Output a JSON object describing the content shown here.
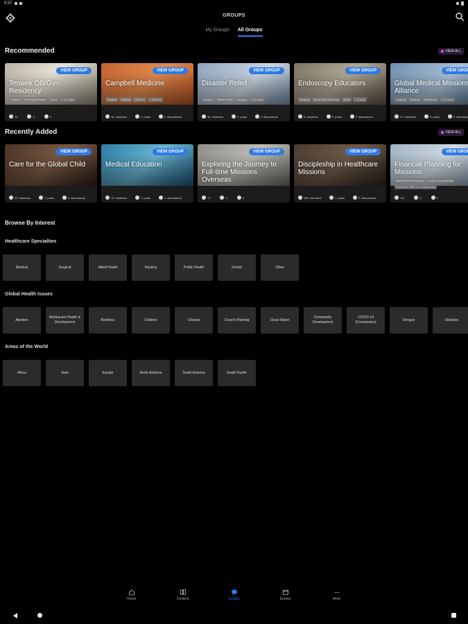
{
  "status_bar": {
    "time": "9:37"
  },
  "header": {
    "title": "GROUPS",
    "tabs": [
      {
        "label": "My Groups",
        "active": false
      },
      {
        "label": "All Groups",
        "active": true
      }
    ]
  },
  "view_group_label": "VIEW GROUP",
  "recommended": {
    "title": "Recommended",
    "view_all": "VIEW ALL",
    "cards": [
      {
        "name": "Tenwek OB/Gyn Residency",
        "chips": [
          "Surgical",
          "Birthing Wellness",
          "Africa",
          "+ 12 more"
        ],
        "stats": {
          "members": "10",
          "posts": "3",
          "discussions": "4"
        },
        "labels": {
          "members": "",
          "posts": "",
          "discussions": ""
        }
      },
      {
        "name": "Campbell Medicine",
        "chips": [
          "Surgical",
          "Medical",
          "Children",
          "+ 29 more"
        ],
        "stats": {
          "members": "16",
          "posts": "1",
          "discussions": "0"
        },
        "labels": {
          "members": "members",
          "posts": "posts",
          "discussions": "discussions"
        }
      },
      {
        "name": "Disaster Relief",
        "chips": [
          "Surgical",
          "Allied Health",
          "Nursing",
          "+ 22 more"
        ],
        "stats": {
          "members": "35",
          "posts": "0",
          "discussions": "2"
        },
        "labels": {
          "members": "members",
          "posts": "posts",
          "discussions": "discussions"
        }
      },
      {
        "name": "Endoscopy Educators",
        "chips": [
          "Surgical",
          "Short-Term Missions",
          "Africa",
          "+ 3 more"
        ],
        "stats": {
          "members": "5",
          "posts": "0",
          "discussions": "2"
        },
        "labels": {
          "members": "members",
          "posts": "posts",
          "discussions": "discussions"
        }
      },
      {
        "name": "Global Medical Missions Alliance",
        "chips": [
          "Surgical",
          "Medical",
          "Residency",
          "+ 22 more"
        ],
        "stats": {
          "members": "17",
          "posts": "0",
          "discussions": "0"
        },
        "labels": {
          "members": "members",
          "posts": "posts",
          "discussions": "discussions"
        }
      }
    ]
  },
  "recently_added": {
    "title": "Recently Added",
    "view_all": "VIEW ALL",
    "cards": [
      {
        "name": "Care for the Global Child",
        "chips": [],
        "stats": {
          "members": "23",
          "posts": "1",
          "discussions": "0"
        },
        "labels": {
          "members": "members",
          "posts": "posts",
          "discussions": "discussions"
        }
      },
      {
        "name": "Medical Education",
        "chips": [],
        "stats": {
          "members": "10",
          "posts": "1",
          "discussions": "1"
        },
        "labels": {
          "members": "members",
          "posts": "posts",
          "discussions": "discussions"
        }
      },
      {
        "name": "Exploring the Journey to Full-time Missions Overseas",
        "chips": [],
        "stats": {
          "members": "17",
          "posts": "0",
          "discussions": "0"
        },
        "labels": {
          "members": "",
          "posts": "",
          "discussions": ""
        }
      },
      {
        "name": "Discipleship in Healthcare Missions",
        "chips": [],
        "stats": {
          "members": "158",
          "posts": "0",
          "discussions": "0"
        },
        "labels": {
          "members": "members",
          "posts": "posts",
          "discussions": "discussions"
        }
      },
      {
        "name": "Financial Planning for Missions",
        "chips": [
          "Medical Press Readers",
          "Long-Term Missions",
          "Reflecting Skills as a Missionary"
        ],
        "stats": {
          "members": "113",
          "posts": "0",
          "discussions": "0"
        },
        "labels": {
          "members": "",
          "posts": "",
          "discussions": ""
        }
      }
    ]
  },
  "browse": {
    "title": "Browse By Interest",
    "healthcare": {
      "title": "Healthcare Specialties",
      "items": [
        "Medical",
        "Surgical",
        "Allied Health",
        "Nursing",
        "Public Health",
        "Dental",
        "Other"
      ]
    },
    "global_health": {
      "title": "Global Health Issues",
      "items": [
        "Abortion",
        "Adolescent Health & Development",
        "Bioethics",
        "Children",
        "Cholera",
        "Church Planting",
        "Clean Water",
        "Community Development",
        "COVID-19 (Coronavirus)",
        "Dengue",
        "Diabetes"
      ]
    },
    "areas": {
      "title": "Areas of the World",
      "items": [
        "Africa",
        "Asia",
        "Europe",
        "North America",
        "South America",
        "South Pacific"
      ]
    }
  },
  "bottom_nav": [
    {
      "label": "Home",
      "icon": "home-icon",
      "active": false
    },
    {
      "label": "Content",
      "icon": "content-icon",
      "active": false
    },
    {
      "label": "Groups",
      "icon": "groups-icon",
      "active": true
    },
    {
      "label": "Events",
      "icon": "calendar-icon",
      "active": false
    },
    {
      "label": "More",
      "icon": "more-icon",
      "active": false
    }
  ],
  "colors": {
    "accent": "#2f7be5",
    "tile_bg": "#2b2b2b",
    "background": "#000000"
  }
}
